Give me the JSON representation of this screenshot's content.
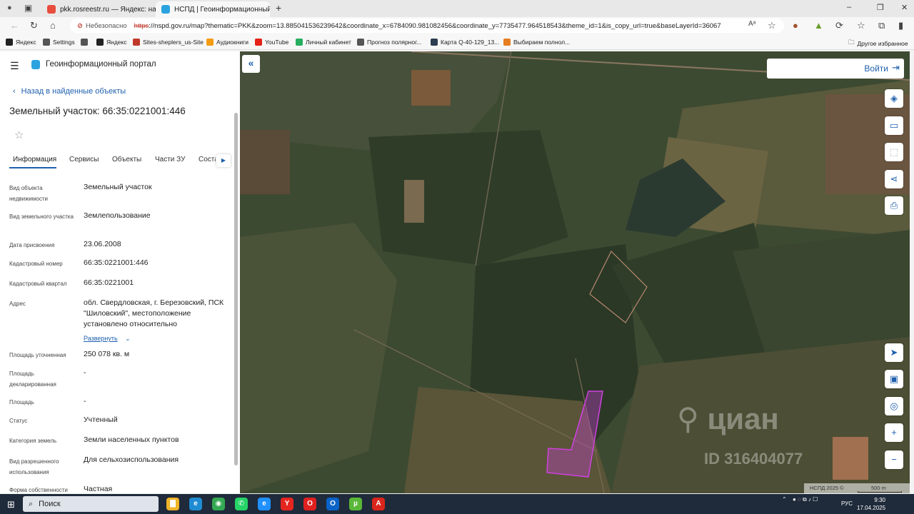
{
  "browser": {
    "tabs": [
      {
        "title": "pkk.rosreestr.ru — Яндекс: нашлось",
        "active": false,
        "favicon_color": "#e74c3c"
      },
      {
        "title": "НСПД | Геоинформационный п",
        "active": true,
        "favicon_color": "#2aa3e0"
      }
    ],
    "new_tab": "+",
    "window_controls": {
      "minimize": "–",
      "maximize": "❐",
      "close": "✕"
    },
    "address": {
      "security_label": "Небезопасно",
      "scheme": "https",
      "url_rest": "://nspd.gov.ru/map?thematic=PKK&zoom=13.885041536239642&coordinate_x=6784090.981082456&coordinate_y=7735477.964518543&theme_id=1&is_copy_url=true&baseLayerId=36067"
    },
    "bookmarks": [
      {
        "label": "Яндекс",
        "color": "#222"
      },
      {
        "label": "Settings",
        "color": "#555"
      },
      {
        "label": "",
        "color": "#555"
      },
      {
        "label": "Яндекс",
        "color": "#222"
      },
      {
        "label": "Sites-sheplers_us-Site",
        "color": "#c0392b"
      },
      {
        "label": "Аудиокниги",
        "color": "#f39c12"
      },
      {
        "label": "YouTube",
        "color": "#e62117"
      },
      {
        "label": "Личный кабинет",
        "color": "#27ae60"
      },
      {
        "label": "Прогноз полярног...",
        "color": "#555"
      },
      {
        "label": "Карта Q-40-129_13...",
        "color": "#2c3e50"
      },
      {
        "label": "Выбираем полнол...",
        "color": "#e67e22"
      }
    ],
    "other_bookmarks": "Другое избранное"
  },
  "panel": {
    "portal_title": "Геоинформационный портал",
    "back_link": "Назад в найденные объекты",
    "object_title": "Земельный участок: 66:35:0221001:446",
    "tabs": [
      "Информация",
      "Сервисы",
      "Объекты",
      "Части ЗУ",
      "Соста"
    ],
    "rows": [
      {
        "label": "Вид объекта недвижимости",
        "value": "Земельный участок"
      },
      {
        "label": "Вид земельного участка",
        "value": "Землепользование"
      },
      {
        "label": "Дата присвоения",
        "value": "23.06.2008"
      },
      {
        "label": "Кадастровый номер",
        "value": "66:35:0221001:446"
      },
      {
        "label": "Кадастровый квартал",
        "value": "66:35:0221001"
      },
      {
        "label": "Адрес",
        "value": "обл. Свердловская, г. Березовский, ПСК \"Шиловский\", местоположение установлено относительно"
      },
      {
        "label": "Площадь уточненная",
        "value": "250 078 кв. м"
      },
      {
        "label": "Площадь декларированная",
        "value": "-"
      },
      {
        "label": "Площадь",
        "value": "-"
      },
      {
        "label": "Статус",
        "value": "Учтенный"
      },
      {
        "label": "Категория земель",
        "value": "Земли населенных пунктов"
      },
      {
        "label": "Вид разрешенного использования",
        "value": "Для сельхозиспользования"
      },
      {
        "label": "Форма собственности",
        "value": "Частная"
      }
    ],
    "expand_link": "Развернуть"
  },
  "map": {
    "login_label": "Войти",
    "watermark_brand": "циан",
    "watermark_id": "ID 316404077",
    "attribution": "НСПД 2025 ©",
    "scale_label": "500 m",
    "parcel_color": "#d040e0",
    "tools": [
      "layers-icon",
      "ruler-icon",
      "select-area-icon",
      "share-icon",
      "print-icon",
      "locate-icon",
      "minimap-icon",
      "geo-search-icon",
      "zoom-in-icon",
      "zoom-out-icon"
    ]
  },
  "taskbar": {
    "search_label": "Поиск",
    "lang": "РУС",
    "time": "9:30",
    "date": "17.04.2025",
    "apps": [
      {
        "name": "file-explorer",
        "color": "#f0b429",
        "glyph": "▇"
      },
      {
        "name": "edge",
        "color": "#1f8bd1",
        "glyph": "e"
      },
      {
        "name": "chrome",
        "color": "#34a853",
        "glyph": "◉"
      },
      {
        "name": "whatsapp",
        "color": "#25d366",
        "glyph": "✆"
      },
      {
        "name": "internet-explorer",
        "color": "#1e90ff",
        "glyph": "e"
      },
      {
        "name": "yandex-browser",
        "color": "#e52620",
        "glyph": "Y"
      },
      {
        "name": "opera",
        "color": "#e0211f",
        "glyph": "O"
      },
      {
        "name": "outlook",
        "color": "#0a64c8",
        "glyph": "O"
      },
      {
        "name": "utorrent",
        "color": "#5ab738",
        "glyph": "µ"
      },
      {
        "name": "acrobat",
        "color": "#d9251c",
        "glyph": "A"
      }
    ]
  }
}
